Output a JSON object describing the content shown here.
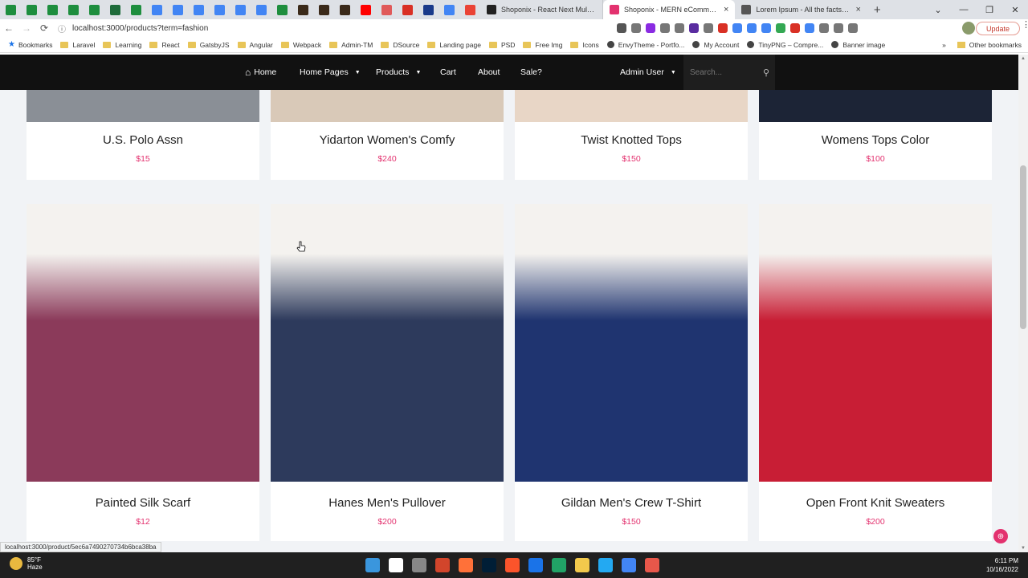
{
  "browser": {
    "tabs": [
      {
        "label": "Shoponix - React Next Multi Vendor",
        "favicon_color": "#222222"
      },
      {
        "label": "Shoponix - MERN eCommerce St...",
        "favicon_color": "#e3326f",
        "active": true
      },
      {
        "label": "Lorem Ipsum - All the facts - Lipsum",
        "favicon_color": "#555555"
      }
    ],
    "close_glyph": "×",
    "new_tab_glyph": "+",
    "pinned_tab_colors": [
      "#1e8e3e",
      "#1e8e3e",
      "#1e8e3e",
      "#1e8e3e",
      "#1e8e3e",
      "#1e6b3a",
      "#1e8e3e",
      "#4285f4",
      "#4285f4",
      "#4285f4",
      "#4285f4",
      "#4285f4",
      "#4285f4",
      "#1e8e3e",
      "#3b2a1a",
      "#3b2a1a",
      "#3b2a1a",
      "#ff0000",
      "#e05a5a",
      "#d93025",
      "#1a3a8a",
      "#4285f4",
      "#ea4335"
    ],
    "window_controls": [
      "⌄",
      "—",
      "❐",
      "✕"
    ],
    "nav": {
      "back": "←",
      "forward": "→",
      "reload": "⟳",
      "info": "ⓘ"
    },
    "url": "localhost:3000/products?term=fashion",
    "extension_colors": [
      "#555555",
      "#777777",
      "#8a2be2",
      "#777777",
      "#777777",
      "#5a2ca0",
      "#777777",
      "#d93025",
      "#4285f4",
      "#4285f4",
      "#4285f4",
      "#34a853",
      "#d93025",
      "#4285f4",
      "#777777",
      "#777777",
      "#777777"
    ],
    "update_label": "Update",
    "menu_glyph": "⋮",
    "bookmarks": [
      {
        "label": "Bookmarks",
        "type": "star"
      },
      {
        "label": "Laravel",
        "type": "folder"
      },
      {
        "label": "Learning",
        "type": "folder"
      },
      {
        "label": "React",
        "type": "folder"
      },
      {
        "label": "GatsbyJS",
        "type": "folder"
      },
      {
        "label": "Angular",
        "type": "folder"
      },
      {
        "label": "Webpack",
        "type": "folder"
      },
      {
        "label": "Admin-TM",
        "type": "folder"
      },
      {
        "label": "DSource",
        "type": "folder"
      },
      {
        "label": "Landing page",
        "type": "folder"
      },
      {
        "label": "PSD",
        "type": "folder"
      },
      {
        "label": "Free Img",
        "type": "folder"
      },
      {
        "label": "Icons",
        "type": "folder"
      },
      {
        "label": "EnvyTheme - Portfo...",
        "type": "site"
      },
      {
        "label": "My Account",
        "type": "site"
      },
      {
        "label": "TinyPNG – Compre...",
        "type": "site"
      },
      {
        "label": "Banner image",
        "type": "site"
      }
    ],
    "bookmarks_more": "»",
    "other_bookmarks": "Other bookmarks",
    "status_url": "localhost:3000/product/5ec6a7490270734b6bca38ba"
  },
  "site_nav": {
    "home": "Home",
    "home_icon": "⌂",
    "home_pages": "Home Pages",
    "products": "Products",
    "cart": "Cart",
    "about": "About",
    "sale": "Sale?",
    "admin": "Admin User",
    "caret": "▼",
    "search_placeholder": "Search...",
    "search_icon": "⚲"
  },
  "products": [
    {
      "name": "U.S. Polo Assn",
      "price": "$15",
      "image_color": "#8a8f96"
    },
    {
      "name": "Yidarton Women's Comfy",
      "price": "$240",
      "image_color": "#d9c9b8"
    },
    {
      "name": "Twist Knotted Tops",
      "price": "$150",
      "image_color": "#e8d6c6"
    },
    {
      "name": "Womens Tops Color",
      "price": "$100",
      "image_color": "#1c2436"
    },
    {
      "name": "Painted Silk Scarf",
      "price": "$12",
      "image_color": "#8b3a5a"
    },
    {
      "name": "Hanes Men's Pullover",
      "price": "$200",
      "image_color": "#2d3a5c"
    },
    {
      "name": "Gildan Men's Crew T-Shirt",
      "price": "$150",
      "image_color": "#1f3470"
    },
    {
      "name": "Open Front Knit Sweaters",
      "price": "$200",
      "image_color": "#c81e35"
    }
  ],
  "fab_glyph": "⊕",
  "scroll_glyphs": {
    "up": "▲",
    "down": "▼"
  },
  "taskbar": {
    "weather_temp": "85°F",
    "weather_desc": "Haze",
    "time": "6:11 PM",
    "date": "10/16/2022",
    "app_colors": [
      "#3a96dd",
      "#ffffff",
      "#888888",
      "#d2452b",
      "#ff7139",
      "#001e36",
      "#fb542b",
      "#1a73e8",
      "#21a366",
      "#f2c94c",
      "#23a9f2",
      "#4285f4",
      "#e8574a"
    ]
  },
  "colors": {
    "accent": "#e3326f",
    "navbar": "#111111",
    "page_bg": "#f1f3f6"
  }
}
